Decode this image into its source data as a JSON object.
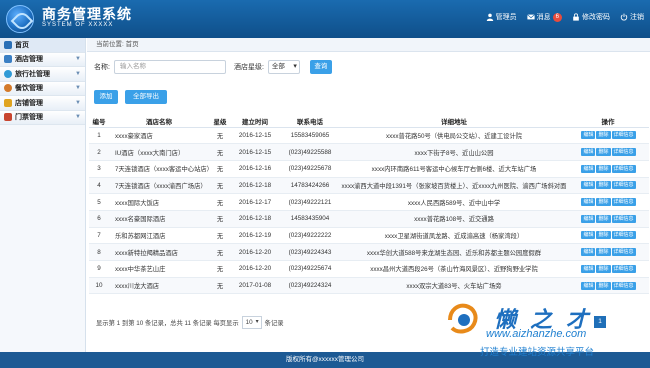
{
  "header": {
    "title": "商务管理系统",
    "subtitle": "SYSTEM OF XXXXX",
    "nav": [
      {
        "label": "管理员",
        "icon": "user-icon"
      },
      {
        "label": "消息",
        "icon": "mail-icon",
        "badge": "6"
      },
      {
        "label": "修改密码",
        "icon": "lock-icon"
      },
      {
        "label": "注销",
        "icon": "power-icon"
      }
    ]
  },
  "sidebar": {
    "items": [
      {
        "label": "首页",
        "icon": "home-icon",
        "color": "#2a6fb6"
      },
      {
        "label": "酒店管理",
        "icon": "hotel-icon",
        "color": "#3a7fc4"
      },
      {
        "label": "旅行社管理",
        "icon": "travel-icon",
        "color": "#2f9ad6"
      },
      {
        "label": "餐饮管理",
        "icon": "food-icon",
        "color": "#d47a2a"
      },
      {
        "label": "店铺管理",
        "icon": "shop-icon",
        "color": "#e0a420"
      },
      {
        "label": "门票管理",
        "icon": "ticket-icon",
        "color": "#c8452f"
      }
    ]
  },
  "breadcrumb": "当前位置: 首页",
  "search": {
    "name_label": "名称:",
    "name_placeholder": "输入名称",
    "star_label": "酒店星级:",
    "star_value": "全部",
    "query_button": "查询"
  },
  "actions": {
    "add": "添加",
    "export_all": "全部导出"
  },
  "table": {
    "columns": [
      "编号",
      "酒店名称",
      "星级",
      "建立时间",
      "联系电话",
      "详细地址",
      "操作"
    ],
    "op_labels": [
      "编辑",
      "删除",
      "详细信息"
    ],
    "rows": [
      [
        "1",
        "xxxx豪家酒店",
        "无",
        "2016-12-15",
        "15583459065",
        "xxxx普花路50号（供电局公交站）、近建工设计院"
      ],
      [
        "2",
        "IU酒店（xxxx大南门店）",
        "无",
        "2016-12-15",
        "(023)49225588",
        "xxxx下街子8号、近山山公园"
      ],
      [
        "3",
        "7天连锁酒店（xxxx客运中心站店）",
        "无",
        "2016-12-16",
        "(023)49225678",
        "xxxx内环南路611号客运中心候车厅右侧6楼、近大车站广场"
      ],
      [
        "4",
        "7天连锁酒店（xxxx渝西广场店）",
        "无",
        "2016-12-18",
        "14783424266",
        "xxxx渝西大道中段1391号（张家坡百货楼上）、近xxxx九州医院、渝西广场斜对面"
      ],
      [
        "5",
        "xxxx国际大饭店",
        "无",
        "2016-12-17",
        "(023)49222121",
        "xxxx人民西路589号、近中山中学"
      ],
      [
        "6",
        "xxxx名豪国际酒店",
        "无",
        "2016-12-18",
        "14583435904",
        "xxxx普花路108号、近交通路"
      ],
      [
        "7",
        "乐和苏都网江酒店",
        "无",
        "2016-12-19",
        "(023)49222222",
        "xxxx卫星湖街道凤龙路、近成渝高速（杨家湾段）"
      ],
      [
        "8",
        "xxxx新特拉羯精品酒店",
        "无",
        "2016-12-20",
        "(023)49224343",
        "xxxx华创大道588号来龙湖生态园、近乐和苏都主题公园度假群"
      ],
      [
        "9",
        "xxxx中华茶艺山庄",
        "无",
        "2016-12-20",
        "(023)49225674",
        "xxxx昌州大道西段26号（茶山竹海风景区）、近野狗野业学院"
      ],
      [
        "10",
        "xxxx川龙大酒店",
        "无",
        "2017-01-08",
        "(023)49224324",
        "xxxx双宗大道83号、火车站广场旁"
      ]
    ]
  },
  "pager": {
    "summary": "显示第 1 到第 10 条记录，总共 11 条记录 每页显示",
    "page_size": "10",
    "suffix": "条记录",
    "current_page": "1"
  },
  "footer": "版权所有@xxxxxx管理公司",
  "watermark": {
    "title": "懒之才",
    "url": "www.aizhanzhe.com",
    "slogan": "打造专业建站资源共享平台"
  }
}
